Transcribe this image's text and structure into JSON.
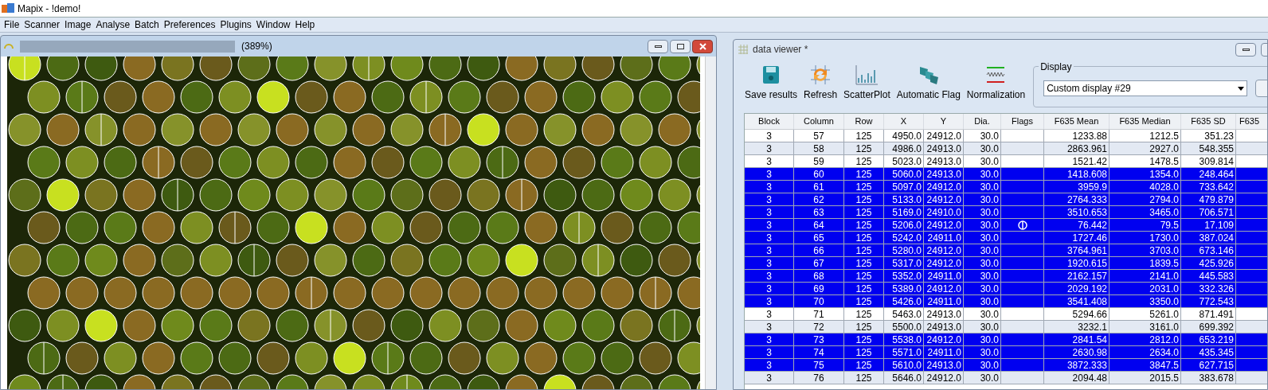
{
  "app_title": "Mapix - !demo!",
  "menu": [
    "File",
    "Scanner",
    "Image",
    "Analyse",
    "Batch",
    "Preferences",
    "Plugins",
    "Window",
    "Help"
  ],
  "image_window": {
    "zoom": "(389%)"
  },
  "data_viewer": {
    "title": "data viewer *",
    "toolbar": [
      {
        "kind": "save",
        "label": "Save results"
      },
      {
        "kind": "refresh",
        "label": "Refresh"
      },
      {
        "kind": "scatter",
        "label": "ScatterPlot"
      },
      {
        "kind": "flag",
        "label": "Automatic Flag"
      },
      {
        "kind": "normalize",
        "label": "Normalization"
      }
    ],
    "display": {
      "label": "Display",
      "value": "Custom display #29"
    },
    "table": {
      "columns": [
        "Block",
        "Column",
        "Row",
        "X",
        "Y",
        "Dia.",
        "Flags",
        "F635 Mean",
        "F635 Median",
        "F635 SD",
        "F635"
      ],
      "rows": [
        {
          "selected": false,
          "flagged": false,
          "cells": [
            "3",
            "57",
            "125",
            "4950.0",
            "24912.0",
            "30.0",
            "",
            "1233.88",
            "1212.5",
            "351.23"
          ]
        },
        {
          "selected": false,
          "flagged": false,
          "cells": [
            "3",
            "58",
            "125",
            "4986.0",
            "24913.0",
            "30.0",
            "",
            "2863.961",
            "2927.0",
            "548.355"
          ]
        },
        {
          "selected": false,
          "flagged": false,
          "cells": [
            "3",
            "59",
            "125",
            "5023.0",
            "24913.0",
            "30.0",
            "",
            "1521.42",
            "1478.5",
            "309.814"
          ]
        },
        {
          "selected": true,
          "flagged": false,
          "cells": [
            "3",
            "60",
            "125",
            "5060.0",
            "24913.0",
            "30.0",
            "",
            "1418.608",
            "1354.0",
            "248.464"
          ]
        },
        {
          "selected": true,
          "flagged": false,
          "cells": [
            "3",
            "61",
            "125",
            "5097.0",
            "24912.0",
            "30.0",
            "",
            "3959.9",
            "4028.0",
            "733.642"
          ]
        },
        {
          "selected": true,
          "flagged": false,
          "cells": [
            "3",
            "62",
            "125",
            "5133.0",
            "24912.0",
            "30.0",
            "",
            "2764.333",
            "2794.0",
            "479.879"
          ]
        },
        {
          "selected": true,
          "flagged": false,
          "cells": [
            "3",
            "63",
            "125",
            "5169.0",
            "24910.0",
            "30.0",
            "",
            "3510.653",
            "3465.0",
            "706.571"
          ]
        },
        {
          "selected": true,
          "flagged": true,
          "cells": [
            "3",
            "64",
            "125",
            "5206.0",
            "24912.0",
            "30.0",
            "",
            "76.442",
            "79.5",
            "17.109"
          ]
        },
        {
          "selected": true,
          "flagged": false,
          "cells": [
            "3",
            "65",
            "125",
            "5242.0",
            "24911.0",
            "30.0",
            "",
            "1727.46",
            "1730.0",
            "387.024"
          ]
        },
        {
          "selected": true,
          "flagged": false,
          "cells": [
            "3",
            "66",
            "125",
            "5280.0",
            "24912.0",
            "30.0",
            "",
            "3764.961",
            "3703.0",
            "673.146"
          ]
        },
        {
          "selected": true,
          "flagged": false,
          "cells": [
            "3",
            "67",
            "125",
            "5317.0",
            "24912.0",
            "30.0",
            "",
            "1920.615",
            "1839.5",
            "425.926"
          ]
        },
        {
          "selected": true,
          "flagged": false,
          "cells": [
            "3",
            "68",
            "125",
            "5352.0",
            "24911.0",
            "30.0",
            "",
            "2162.157",
            "2141.0",
            "445.583"
          ]
        },
        {
          "selected": true,
          "flagged": false,
          "cells": [
            "3",
            "69",
            "125",
            "5389.0",
            "24912.0",
            "30.0",
            "",
            "2029.192",
            "2031.0",
            "332.326"
          ]
        },
        {
          "selected": true,
          "flagged": false,
          "cells": [
            "3",
            "70",
            "125",
            "5426.0",
            "24911.0",
            "30.0",
            "",
            "3541.408",
            "3350.0",
            "772.543"
          ]
        },
        {
          "selected": false,
          "flagged": false,
          "cells": [
            "3",
            "71",
            "125",
            "5463.0",
            "24913.0",
            "30.0",
            "",
            "5294.66",
            "5261.0",
            "871.491"
          ]
        },
        {
          "selected": false,
          "flagged": false,
          "cells": [
            "3",
            "72",
            "125",
            "5500.0",
            "24913.0",
            "30.0",
            "",
            "3232.1",
            "3161.0",
            "699.392"
          ]
        },
        {
          "selected": true,
          "flagged": false,
          "cells": [
            "3",
            "73",
            "125",
            "5538.0",
            "24912.0",
            "30.0",
            "",
            "2841.54",
            "2812.0",
            "653.219"
          ]
        },
        {
          "selected": true,
          "flagged": false,
          "cells": [
            "3",
            "74",
            "125",
            "5571.0",
            "24911.0",
            "30.0",
            "",
            "2630.98",
            "2634.0",
            "435.345"
          ]
        },
        {
          "selected": true,
          "flagged": false,
          "cells": [
            "3",
            "75",
            "125",
            "5610.0",
            "24913.0",
            "30.0",
            "",
            "3872.333",
            "3847.5",
            "627.715"
          ]
        },
        {
          "selected": false,
          "flagged": false,
          "cells": [
            "3",
            "76",
            "125",
            "5646.0",
            "24912.0",
            "30.0",
            "",
            "2094.48",
            "2015.5",
            "383.678"
          ]
        }
      ]
    }
  }
}
